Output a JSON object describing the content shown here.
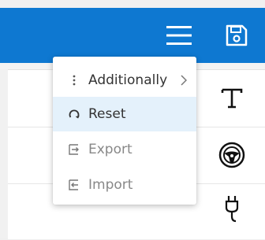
{
  "toolbar": {
    "menu_icon": "hamburger-icon",
    "save_icon": "save-icon",
    "color": "#0e78d1"
  },
  "menu": {
    "items": [
      {
        "label": "Additionally",
        "icon": "more-vertical-icon",
        "has_submenu": true
      },
      {
        "label": "Reset",
        "icon": "reset-icon",
        "selected": true
      },
      {
        "label": "Export",
        "icon": "export-icon",
        "disabled": true
      },
      {
        "label": "Import",
        "icon": "import-icon",
        "disabled": true
      }
    ]
  },
  "tools": [
    {
      "icon": "text-tool-icon"
    },
    {
      "icon": "steering-wheel-icon"
    },
    {
      "icon": "power-plug-icon"
    }
  ]
}
